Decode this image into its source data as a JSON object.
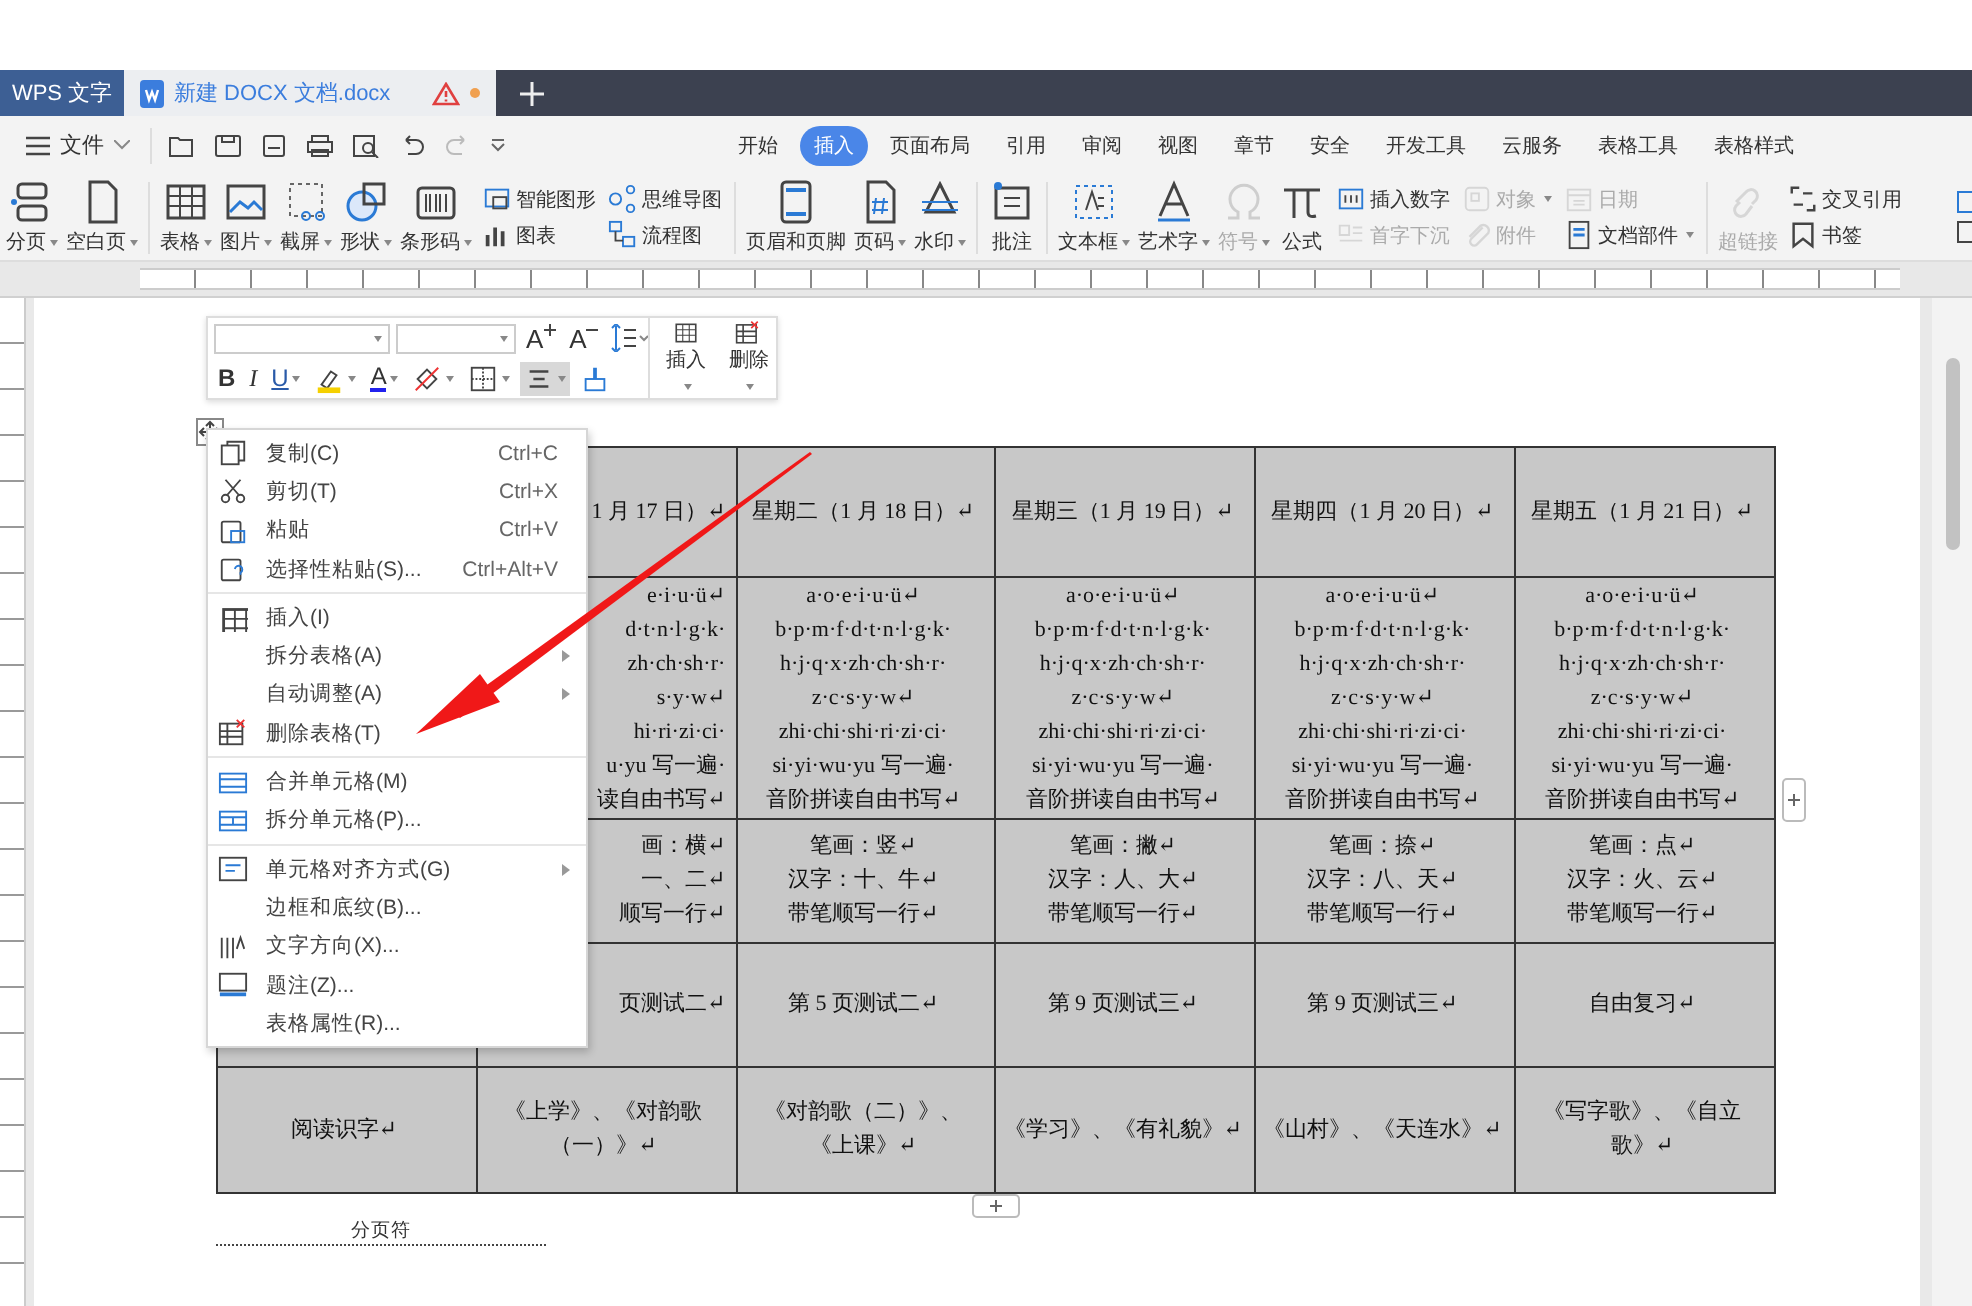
{
  "tabs_bar": {
    "app_tab": "WPS 文字",
    "document_tab": {
      "title": "新建 DOCX 文档.docx",
      "warning": true,
      "modified": true
    }
  },
  "menu_bar": {
    "file_menu": "文件",
    "tabs": [
      {
        "label": "开始",
        "selected": false
      },
      {
        "label": "插入",
        "selected": true
      },
      {
        "label": "页面布局",
        "selected": false
      },
      {
        "label": "引用",
        "selected": false
      },
      {
        "label": "审阅",
        "selected": false
      },
      {
        "label": "视图",
        "selected": false
      },
      {
        "label": "章节",
        "selected": false
      },
      {
        "label": "安全",
        "selected": false
      },
      {
        "label": "开发工具",
        "selected": false
      },
      {
        "label": "云服务",
        "selected": false
      },
      {
        "label": "表格工具",
        "selected": false
      },
      {
        "label": "表格样式",
        "selected": false
      }
    ]
  },
  "ribbon": {
    "groups": [
      [
        {
          "kind": "big",
          "label": "分页",
          "dropdown": true,
          "disabled": false
        },
        {
          "kind": "big",
          "label": "空白页",
          "dropdown": true,
          "disabled": false
        }
      ],
      [
        {
          "kind": "big",
          "label": "表格",
          "dropdown": true,
          "disabled": false
        },
        {
          "kind": "big",
          "label": "图片",
          "dropdown": true,
          "disabled": false
        },
        {
          "kind": "big",
          "label": "截屏",
          "dropdown": true,
          "disabled": false
        },
        {
          "kind": "big",
          "label": "形状",
          "dropdown": true,
          "disabled": false
        },
        {
          "kind": "big",
          "label": "条形码",
          "dropdown": true,
          "disabled": false
        },
        {
          "kind": "stack",
          "items": [
            {
              "label": "智能图形",
              "dropdown": false,
              "disabled": false
            },
            {
              "label": "图表",
              "dropdown": false,
              "disabled": false
            }
          ]
        },
        {
          "kind": "stack",
          "items": [
            {
              "label": "思维导图",
              "dropdown": false,
              "disabled": false
            },
            {
              "label": "流程图",
              "dropdown": false,
              "disabled": false
            }
          ]
        }
      ],
      [
        {
          "kind": "big",
          "label": "页眉和页脚",
          "dropdown": false,
          "disabled": false
        },
        {
          "kind": "big",
          "label": "页码",
          "dropdown": true,
          "disabled": false
        },
        {
          "kind": "big",
          "label": "水印",
          "dropdown": true,
          "disabled": false
        }
      ],
      [
        {
          "kind": "big",
          "label": "批注",
          "dropdown": false,
          "disabled": false
        }
      ],
      [
        {
          "kind": "big",
          "label": "文本框",
          "dropdown": true,
          "disabled": false
        },
        {
          "kind": "big",
          "label": "艺术字",
          "dropdown": true,
          "disabled": false
        },
        {
          "kind": "big",
          "label": "符号",
          "dropdown": true,
          "disabled": true
        },
        {
          "kind": "big",
          "label": "公式",
          "dropdown": false,
          "disabled": false
        },
        {
          "kind": "stack",
          "items": [
            {
              "label": "插入数字",
              "dropdown": false,
              "disabled": false
            },
            {
              "label": "首字下沉",
              "dropdown": false,
              "disabled": true
            }
          ]
        },
        {
          "kind": "stack",
          "items": [
            {
              "label": "对象",
              "dropdown": true,
              "disabled": true
            },
            {
              "label": "附件",
              "dropdown": false,
              "disabled": true
            }
          ]
        },
        {
          "kind": "stack",
          "items": [
            {
              "label": "日期",
              "dropdown": false,
              "disabled": true
            },
            {
              "label": "文档部件",
              "dropdown": true,
              "disabled": false
            }
          ]
        }
      ],
      [
        {
          "kind": "big",
          "label": "超链接",
          "dropdown": false,
          "disabled": true
        },
        {
          "kind": "stack",
          "items": [
            {
              "label": "交叉引用",
              "dropdown": false,
              "disabled": false
            },
            {
              "label": "书签",
              "dropdown": false,
              "disabled": false
            }
          ]
        }
      ]
    ]
  },
  "mini_toolbar": {
    "size_buttons": [
      {
        "kind": "grow",
        "label": "A"
      },
      {
        "kind": "shrink",
        "label": "A"
      },
      {
        "kind": "spacing"
      }
    ],
    "format_buttons": [
      {
        "kind": "bold",
        "label": "B",
        "dropdown": false,
        "selected": false
      },
      {
        "kind": "italic",
        "label": "I",
        "dropdown": false,
        "selected": false
      },
      {
        "kind": "underline",
        "label": "U",
        "dropdown": true,
        "selected": false
      },
      {
        "kind": "highlight",
        "dropdown": true,
        "selected": false
      },
      {
        "kind": "font-color",
        "label": "A",
        "dropdown": true,
        "selected": false
      },
      {
        "kind": "shading",
        "dropdown": true,
        "selected": false
      },
      {
        "kind": "borders",
        "dropdown": true,
        "selected": false
      },
      {
        "kind": "align",
        "dropdown": true,
        "selected": true
      },
      {
        "kind": "painter",
        "dropdown": false,
        "selected": false
      }
    ],
    "big_buttons": [
      {
        "label": "插入",
        "dropdown": true
      },
      {
        "label": "删除",
        "dropdown": true
      }
    ]
  },
  "table": {
    "rows": [
      {
        "cells": [
          {},
          {
            "lines": [
              "1 月 17 日）↵"
            ]
          },
          {
            "lines": [
              "星期二（1 月 18 日）↵"
            ]
          },
          {
            "lines": [
              "星期三（1 月 19 日）↵"
            ]
          },
          {
            "lines": [
              "星期四（1 月 20 日）↵"
            ]
          },
          {
            "lines": [
              "星期五（1 月 21 日）↵"
            ]
          }
        ]
      },
      {
        "cells": [
          {},
          {
            "lines": [
              "e·i·u·ü↵",
              "d·t·n·l·g·k·",
              "zh·ch·sh·r·",
              "s·y·w↵",
              "hi·ri·zi·ci·",
              "u·yu 写一遍·",
              "读自由书写↵"
            ]
          },
          {
            "lines": [
              "a·o·e·i·u·ü↵",
              "b·p·m·f·d·t·n·l·g·k·",
              "h·j·q·x·zh·ch·sh·r·",
              "z·c·s·y·w↵",
              "zhi·chi·shi·ri·zi·ci·",
              "si·yi·wu·yu 写一遍·",
              "音阶拼读自由书写↵"
            ]
          },
          {
            "lines": [
              "a·o·e·i·u·ü↵",
              "b·p·m·f·d·t·n·l·g·k·",
              "h·j·q·x·zh·ch·sh·r·",
              "z·c·s·y·w↵",
              "zhi·chi·shi·ri·zi·ci·",
              "si·yi·wu·yu 写一遍·",
              "音阶拼读自由书写↵"
            ]
          },
          {
            "lines": [
              "a·o·e·i·u·ü↵",
              "b·p·m·f·d·t·n·l·g·k·",
              "h·j·q·x·zh·ch·sh·r·",
              "z·c·s·y·w↵",
              "zhi·chi·shi·ri·zi·ci·",
              "si·yi·wu·yu 写一遍·",
              "音阶拼读自由书写↵"
            ]
          },
          {
            "lines": [
              "a·o·e·i·u·ü↵",
              "b·p·m·f·d·t·n·l·g·k·",
              "h·j·q·x·zh·ch·sh·r·",
              "z·c·s·y·w↵",
              "zhi·chi·shi·ri·zi·ci·",
              "si·yi·wu·yu 写一遍·",
              "音阶拼读自由书写↵"
            ]
          }
        ]
      },
      {
        "cells": [
          {},
          {
            "lines": [
              "画：横↵",
              "一、二↵",
              "顺写一行↵"
            ]
          },
          {
            "lines": [
              "笔画：竖↵",
              "汉字：十、牛↵",
              "带笔顺写一行↵"
            ]
          },
          {
            "lines": [
              "笔画：撇↵",
              "汉字：人、大↵",
              "带笔顺写一行↵"
            ]
          },
          {
            "lines": [
              "笔画：捺↵",
              "汉字：八、天↵",
              "带笔顺写一行↵"
            ]
          },
          {
            "lines": [
              "笔画：点↵",
              "汉字：火、云↵",
              "带笔顺写一行↵"
            ]
          }
        ]
      },
      {
        "cells": [
          {},
          {
            "lines": [
              "页测试二↵"
            ]
          },
          {
            "lines": [
              "第 5 页测试二↵"
            ]
          },
          {
            "lines": [
              "第 9 页测试三↵"
            ]
          },
          {
            "lines": [
              "第 9 页测试三↵"
            ]
          },
          {
            "lines": [
              "自由复习↵"
            ]
          }
        ]
      },
      {
        "cells": [
          {
            "lines": [
              "阅读识字↵"
            ]
          },
          {
            "lines": [
              "《上学》、《对韵歌",
              "（一）》↵"
            ]
          },
          {
            "lines": [
              "《对韵歌（二）》、",
              "《上课》↵"
            ]
          },
          {
            "lines": [
              "《学习》、《有礼貌》↵"
            ]
          },
          {
            "lines": [
              "《山村》、《天连水》↵"
            ]
          },
          {
            "lines": [
              "《写字歌》、《自立",
              "歌》↵"
            ]
          }
        ]
      }
    ]
  },
  "page_break": "分页符",
  "context_menu": {
    "groups": [
      [
        {
          "label": "复制(C)",
          "shortcut": "Ctrl+C",
          "submenu": false
        },
        {
          "label": "剪切(T)",
          "shortcut": "Ctrl+X",
          "submenu": false
        },
        {
          "label": "粘贴",
          "shortcut": "Ctrl+V",
          "submenu": false
        },
        {
          "label": "选择性粘贴(S)...",
          "shortcut": "Ctrl+Alt+V",
          "submenu": false
        }
      ],
      [
        {
          "label": "插入(I)",
          "submenu": false
        },
        {
          "label": "拆分表格(A)",
          "submenu": true
        },
        {
          "label": "自动调整(A)",
          "submenu": true
        },
        {
          "label": "删除表格(T)",
          "submenu": false
        }
      ],
      [
        {
          "label": "合并单元格(M)",
          "submenu": false
        },
        {
          "label": "拆分单元格(P)...",
          "submenu": false
        }
      ],
      [
        {
          "label": "单元格对齐方式(G)",
          "submenu": true
        },
        {
          "label": "边框和底纹(B)...",
          "submenu": false
        },
        {
          "label": "文字方向(X)...",
          "submenu": false
        },
        {
          "label": "题注(Z)...",
          "submenu": false
        },
        {
          "label": "表格属性(R)...",
          "submenu": false
        }
      ]
    ]
  }
}
